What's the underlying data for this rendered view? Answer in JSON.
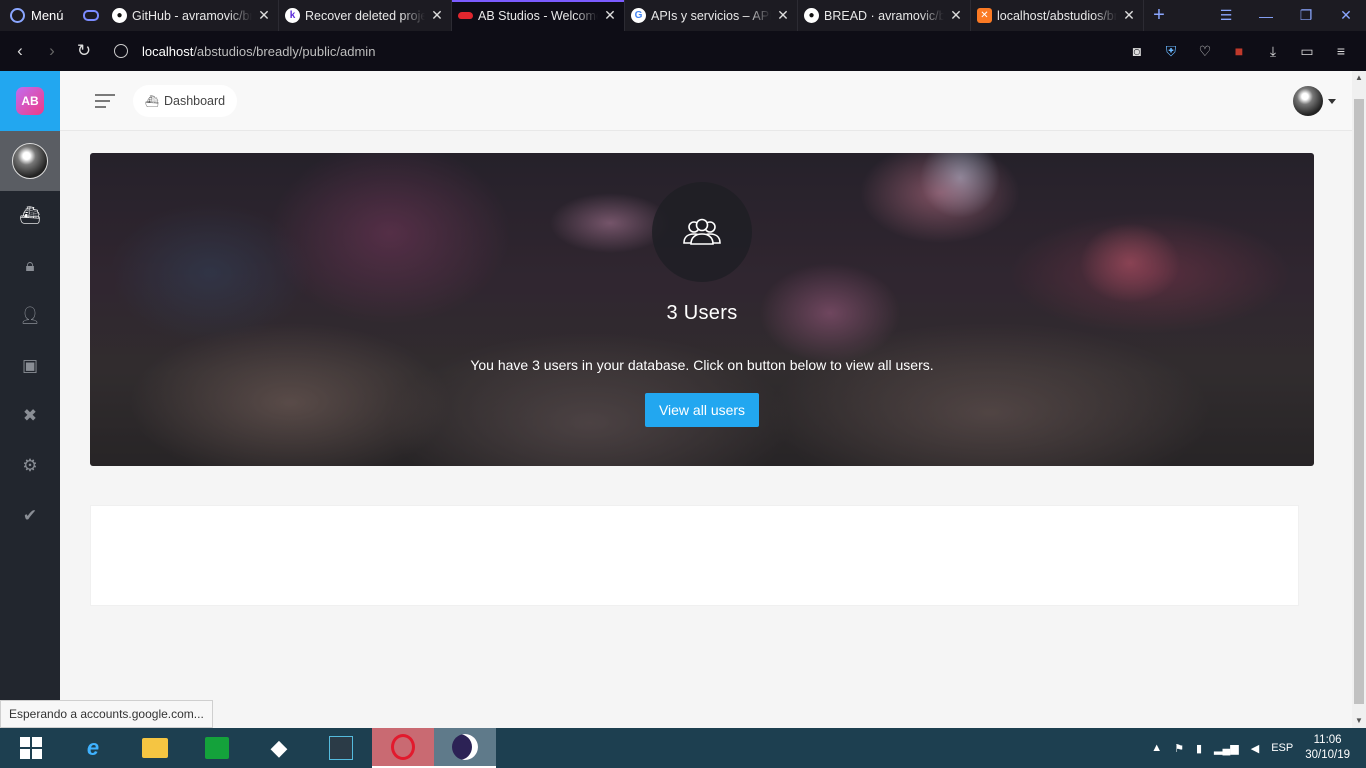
{
  "browser": {
    "menu_label": "Menú",
    "tabs": [
      {
        "title": "GitHub - avramovic/bread",
        "favicon": "github-icon"
      },
      {
        "title": "Recover deleted projects",
        "favicon": "k-icon"
      },
      {
        "title": "AB Studios - Welcome",
        "favicon": "ab-lips-icon",
        "active": true
      },
      {
        "title": "APIs y servicios – APIs",
        "favicon": "google-icon"
      },
      {
        "title": "BREAD · avramovic/bread",
        "favicon": "github-icon"
      },
      {
        "title": "localhost/abstudios/bread",
        "favicon": "xampp-icon"
      }
    ],
    "url_host": "localhost",
    "url_path": "/abstudios/breadly/public/admin"
  },
  "sidebar": {
    "logo_text": "AB",
    "items": [
      {
        "name": "dashboard",
        "icon": "boat-icon",
        "active": true
      },
      {
        "name": "roles",
        "icon": "lock-icon"
      },
      {
        "name": "users",
        "icon": "person-icon"
      },
      {
        "name": "media",
        "icon": "images-icon"
      },
      {
        "name": "tools",
        "icon": "tools-icon"
      },
      {
        "name": "settings",
        "icon": "gear-icon"
      },
      {
        "name": "check",
        "icon": "check-circle-icon"
      }
    ]
  },
  "header": {
    "breadcrumb": "Dashboard"
  },
  "hero": {
    "count_title": "3 Users",
    "description": "You have 3 users in your database. Click on button below to view all users.",
    "button_label": "View all users",
    "accent": "#22a7f0"
  },
  "status_popup": "Esperando a accounts.google.com...",
  "taskbar": {
    "lang": "ESP",
    "time": "11:06",
    "date": "30/10/19"
  }
}
